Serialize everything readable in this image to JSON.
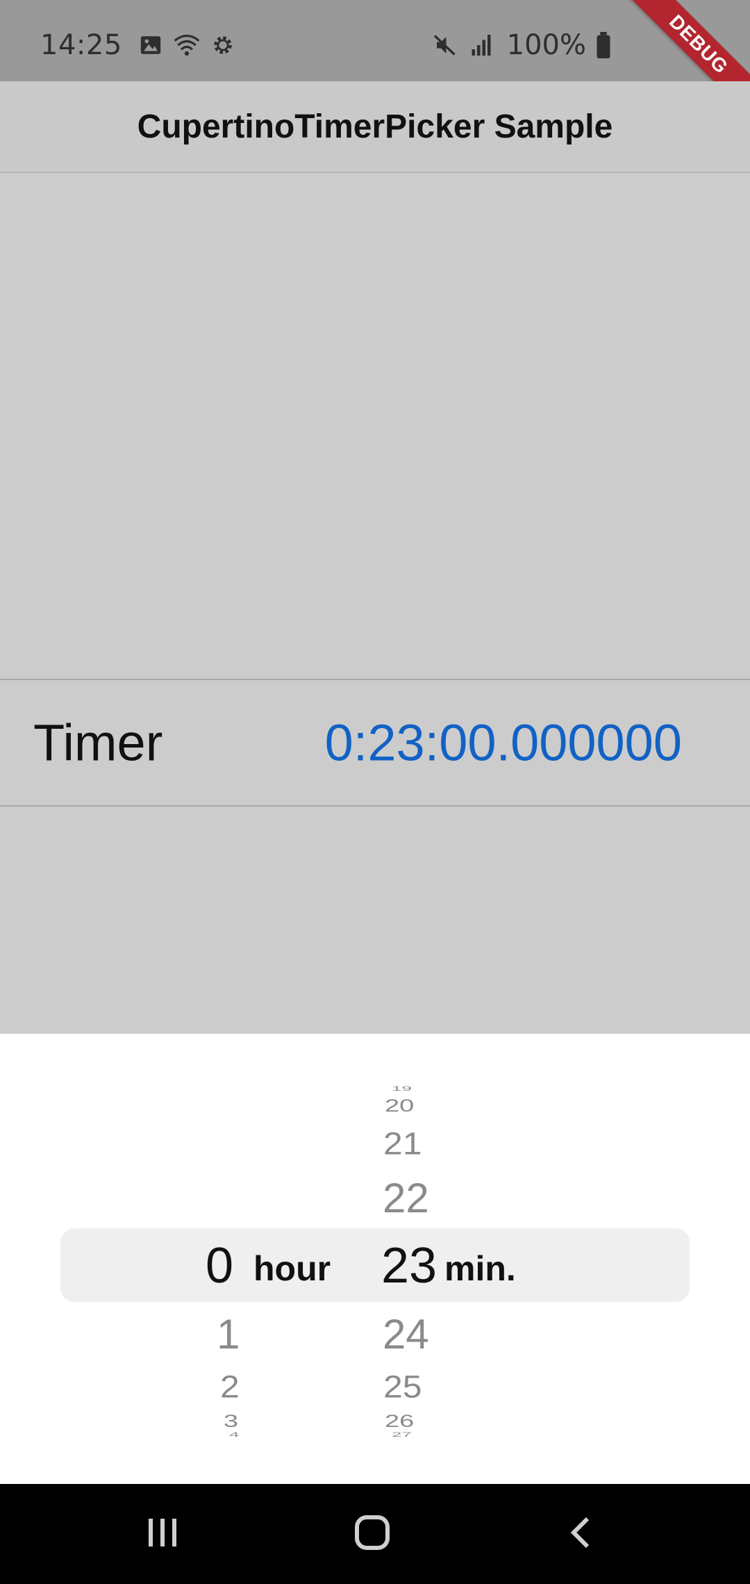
{
  "status_bar": {
    "time": "14:25",
    "battery": "100%",
    "icons_left": [
      "image-icon",
      "wifi-icon",
      "settings-icon"
    ],
    "icons_right": [
      "mute-icon",
      "signal-icon",
      "battery-icon"
    ]
  },
  "debug_ribbon": {
    "label": "DEBUG",
    "color": "#b3262f"
  },
  "app_bar": {
    "title": "CupertinoTimerPicker Sample"
  },
  "timer": {
    "label": "Timer",
    "value": "0:23:00.000000",
    "value_color": "#1162c4"
  },
  "picker": {
    "hour": {
      "selected": "0",
      "unit": "hour",
      "below": [
        "1",
        "2",
        "3",
        "4"
      ]
    },
    "minute": {
      "selected": "23",
      "unit": "min.",
      "above": [
        "19",
        "20",
        "21",
        "22"
      ],
      "below": [
        "24",
        "25",
        "26",
        "27"
      ]
    }
  },
  "nav_bar": {
    "buttons": [
      "recents-icon",
      "home-icon",
      "back-icon"
    ]
  }
}
